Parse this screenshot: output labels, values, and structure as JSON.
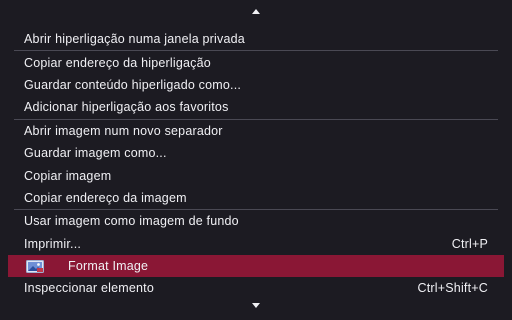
{
  "menu": {
    "scroll_up_icon": "chevron-up-icon",
    "scroll_down_icon": "chevron-down-icon",
    "items": [
      {
        "label": "Abrir hiperligação numa janela privada",
        "shortcut": ""
      },
      {
        "label": "Copiar endereço da hiperligação",
        "shortcut": ""
      },
      {
        "label": "Guardar conteúdo hiperligado como...",
        "shortcut": ""
      },
      {
        "label": "Adicionar hiperligação aos favoritos",
        "shortcut": ""
      },
      {
        "label": "Abrir imagem num novo separador",
        "shortcut": ""
      },
      {
        "label": "Guardar imagem como...",
        "shortcut": ""
      },
      {
        "label": "Copiar imagem",
        "shortcut": ""
      },
      {
        "label": "Copiar endereço da imagem",
        "shortcut": ""
      },
      {
        "label": "Usar imagem como imagem de fundo",
        "shortcut": ""
      },
      {
        "label": "Imprimir...",
        "shortcut": "Ctrl+P"
      },
      {
        "label": "Format Image",
        "shortcut": "",
        "icon": "format-image-icon",
        "highlighted": true
      },
      {
        "label": "Inspeccionar elemento",
        "shortcut": "Ctrl+Shift+C"
      }
    ]
  },
  "colors": {
    "background": "#1c1b22",
    "text": "#f0f0f4",
    "highlight": "#8a1735",
    "separator": "#4a4954"
  }
}
